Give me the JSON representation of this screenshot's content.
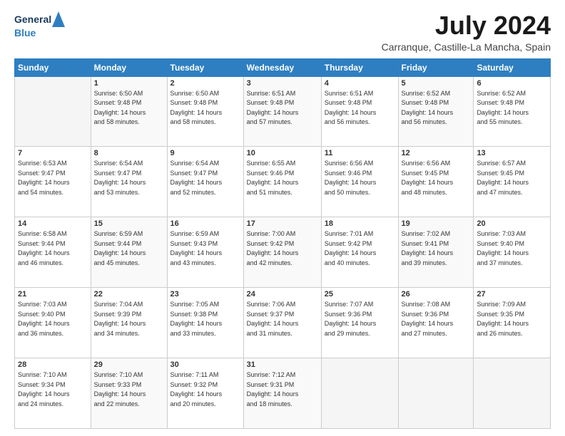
{
  "header": {
    "logo_general": "General",
    "logo_blue": "Blue",
    "title": "July 2024",
    "subtitle": "Carranque, Castille-La Mancha, Spain"
  },
  "calendar": {
    "days_header": [
      "Sunday",
      "Monday",
      "Tuesday",
      "Wednesday",
      "Thursday",
      "Friday",
      "Saturday"
    ],
    "weeks": [
      [
        {
          "day": "",
          "info": ""
        },
        {
          "day": "1",
          "info": "Sunrise: 6:50 AM\nSunset: 9:48 PM\nDaylight: 14 hours\nand 58 minutes."
        },
        {
          "day": "2",
          "info": "Sunrise: 6:50 AM\nSunset: 9:48 PM\nDaylight: 14 hours\nand 58 minutes."
        },
        {
          "day": "3",
          "info": "Sunrise: 6:51 AM\nSunset: 9:48 PM\nDaylight: 14 hours\nand 57 minutes."
        },
        {
          "day": "4",
          "info": "Sunrise: 6:51 AM\nSunset: 9:48 PM\nDaylight: 14 hours\nand 56 minutes."
        },
        {
          "day": "5",
          "info": "Sunrise: 6:52 AM\nSunset: 9:48 PM\nDaylight: 14 hours\nand 56 minutes."
        },
        {
          "day": "6",
          "info": "Sunrise: 6:52 AM\nSunset: 9:48 PM\nDaylight: 14 hours\nand 55 minutes."
        }
      ],
      [
        {
          "day": "7",
          "info": "Sunrise: 6:53 AM\nSunset: 9:47 PM\nDaylight: 14 hours\nand 54 minutes."
        },
        {
          "day": "8",
          "info": "Sunrise: 6:54 AM\nSunset: 9:47 PM\nDaylight: 14 hours\nand 53 minutes."
        },
        {
          "day": "9",
          "info": "Sunrise: 6:54 AM\nSunset: 9:47 PM\nDaylight: 14 hours\nand 52 minutes."
        },
        {
          "day": "10",
          "info": "Sunrise: 6:55 AM\nSunset: 9:46 PM\nDaylight: 14 hours\nand 51 minutes."
        },
        {
          "day": "11",
          "info": "Sunrise: 6:56 AM\nSunset: 9:46 PM\nDaylight: 14 hours\nand 50 minutes."
        },
        {
          "day": "12",
          "info": "Sunrise: 6:56 AM\nSunset: 9:45 PM\nDaylight: 14 hours\nand 48 minutes."
        },
        {
          "day": "13",
          "info": "Sunrise: 6:57 AM\nSunset: 9:45 PM\nDaylight: 14 hours\nand 47 minutes."
        }
      ],
      [
        {
          "day": "14",
          "info": "Sunrise: 6:58 AM\nSunset: 9:44 PM\nDaylight: 14 hours\nand 46 minutes."
        },
        {
          "day": "15",
          "info": "Sunrise: 6:59 AM\nSunset: 9:44 PM\nDaylight: 14 hours\nand 45 minutes."
        },
        {
          "day": "16",
          "info": "Sunrise: 6:59 AM\nSunset: 9:43 PM\nDaylight: 14 hours\nand 43 minutes."
        },
        {
          "day": "17",
          "info": "Sunrise: 7:00 AM\nSunset: 9:42 PM\nDaylight: 14 hours\nand 42 minutes."
        },
        {
          "day": "18",
          "info": "Sunrise: 7:01 AM\nSunset: 9:42 PM\nDaylight: 14 hours\nand 40 minutes."
        },
        {
          "day": "19",
          "info": "Sunrise: 7:02 AM\nSunset: 9:41 PM\nDaylight: 14 hours\nand 39 minutes."
        },
        {
          "day": "20",
          "info": "Sunrise: 7:03 AM\nSunset: 9:40 PM\nDaylight: 14 hours\nand 37 minutes."
        }
      ],
      [
        {
          "day": "21",
          "info": "Sunrise: 7:03 AM\nSunset: 9:40 PM\nDaylight: 14 hours\nand 36 minutes."
        },
        {
          "day": "22",
          "info": "Sunrise: 7:04 AM\nSunset: 9:39 PM\nDaylight: 14 hours\nand 34 minutes."
        },
        {
          "day": "23",
          "info": "Sunrise: 7:05 AM\nSunset: 9:38 PM\nDaylight: 14 hours\nand 33 minutes."
        },
        {
          "day": "24",
          "info": "Sunrise: 7:06 AM\nSunset: 9:37 PM\nDaylight: 14 hours\nand 31 minutes."
        },
        {
          "day": "25",
          "info": "Sunrise: 7:07 AM\nSunset: 9:36 PM\nDaylight: 14 hours\nand 29 minutes."
        },
        {
          "day": "26",
          "info": "Sunrise: 7:08 AM\nSunset: 9:36 PM\nDaylight: 14 hours\nand 27 minutes."
        },
        {
          "day": "27",
          "info": "Sunrise: 7:09 AM\nSunset: 9:35 PM\nDaylight: 14 hours\nand 26 minutes."
        }
      ],
      [
        {
          "day": "28",
          "info": "Sunrise: 7:10 AM\nSunset: 9:34 PM\nDaylight: 14 hours\nand 24 minutes."
        },
        {
          "day": "29",
          "info": "Sunrise: 7:10 AM\nSunset: 9:33 PM\nDaylight: 14 hours\nand 22 minutes."
        },
        {
          "day": "30",
          "info": "Sunrise: 7:11 AM\nSunset: 9:32 PM\nDaylight: 14 hours\nand 20 minutes."
        },
        {
          "day": "31",
          "info": "Sunrise: 7:12 AM\nSunset: 9:31 PM\nDaylight: 14 hours\nand 18 minutes."
        },
        {
          "day": "",
          "info": ""
        },
        {
          "day": "",
          "info": ""
        },
        {
          "day": "",
          "info": ""
        }
      ]
    ]
  }
}
